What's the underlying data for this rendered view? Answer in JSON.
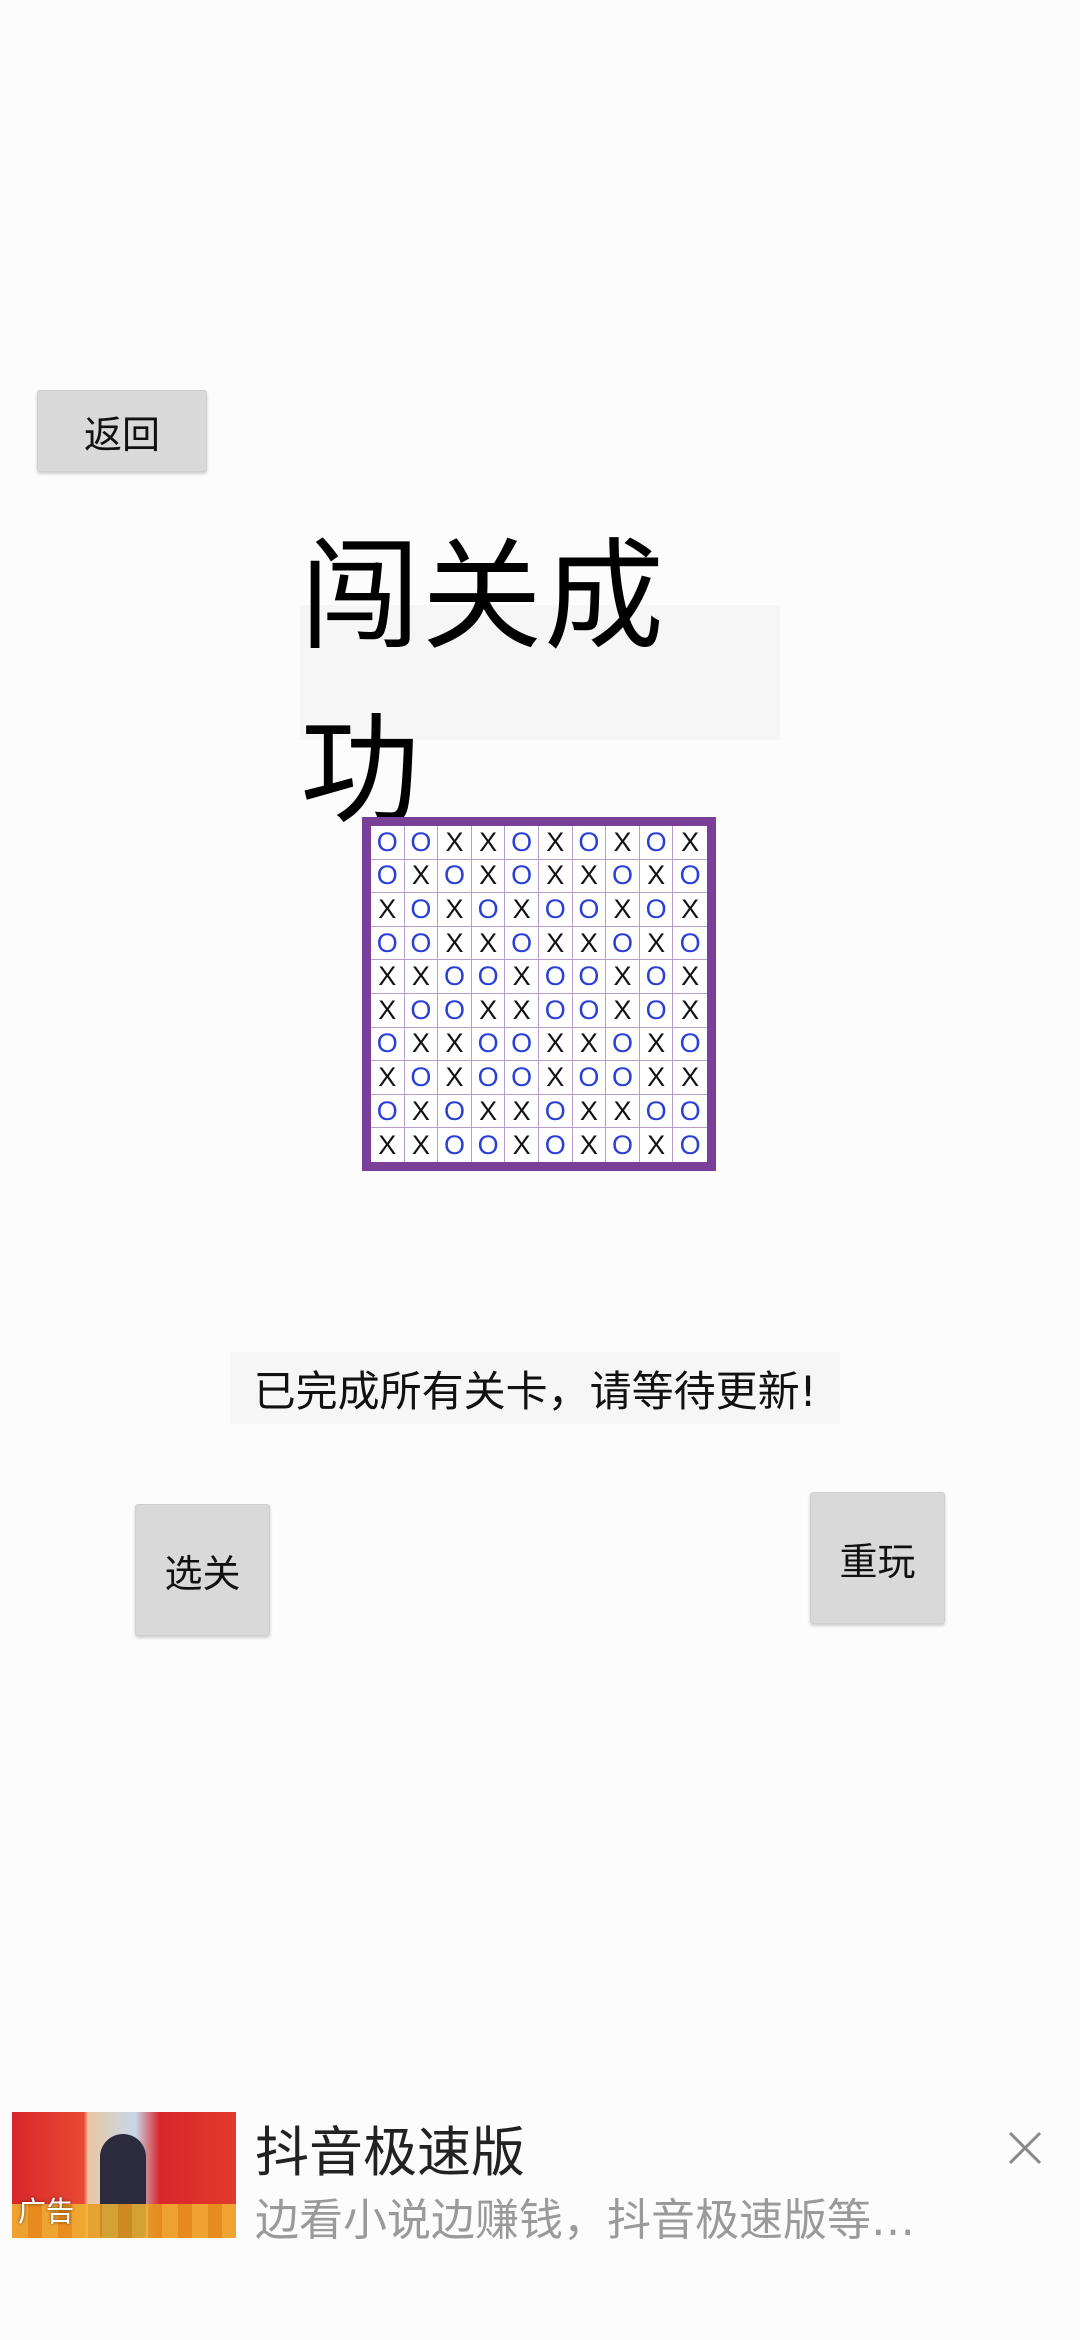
{
  "buttons": {
    "back": "返回",
    "select_level": "选关",
    "replay": "重玩"
  },
  "title": "闯关成功",
  "message": "已完成所有关卡，请等待更新!",
  "board": {
    "rows": [
      [
        "O",
        "O",
        "X",
        "X",
        "O",
        "X",
        "O",
        "X",
        "O",
        "X"
      ],
      [
        "O",
        "X",
        "O",
        "X",
        "O",
        "X",
        "X",
        "O",
        "X",
        "O"
      ],
      [
        "X",
        "O",
        "X",
        "O",
        "X",
        "O",
        "O",
        "X",
        "O",
        "X"
      ],
      [
        "O",
        "O",
        "X",
        "X",
        "O",
        "X",
        "X",
        "O",
        "X",
        "O"
      ],
      [
        "X",
        "X",
        "O",
        "O",
        "X",
        "O",
        "O",
        "X",
        "O",
        "X"
      ],
      [
        "X",
        "O",
        "O",
        "X",
        "X",
        "O",
        "O",
        "X",
        "O",
        "X"
      ],
      [
        "O",
        "X",
        "X",
        "O",
        "O",
        "X",
        "X",
        "O",
        "X",
        "O"
      ],
      [
        "X",
        "O",
        "X",
        "O",
        "O",
        "X",
        "O",
        "O",
        "X",
        "X"
      ],
      [
        "O",
        "X",
        "O",
        "X",
        "X",
        "O",
        "X",
        "X",
        "O",
        "O"
      ],
      [
        "X",
        "X",
        "O",
        "O",
        "X",
        "O",
        "X",
        "O",
        "X",
        "O"
      ]
    ],
    "colors": {
      "border": "#7a3f98",
      "x": "#111111",
      "o": "#2a3fd6"
    }
  },
  "ad": {
    "app_name": "抖音极速版",
    "description": "边看小说边赚钱，抖音极速版等…",
    "tag": "广告",
    "close_icon": "close-icon"
  }
}
